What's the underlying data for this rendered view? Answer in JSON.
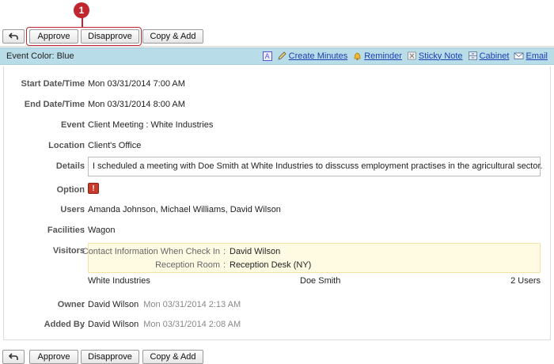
{
  "callout": {
    "number": "1"
  },
  "toolbar": {
    "approve_label": "Approve",
    "disapprove_label": "Disapprove",
    "copy_add_label": "Copy & Add"
  },
  "event_color": "Event Color: Blue",
  "actions": [
    {
      "label": "A",
      "icon": "label-icon"
    },
    {
      "label": "Create Minutes",
      "icon": "pencil-icon"
    },
    {
      "label": "Reminder",
      "icon": "bell-icon"
    },
    {
      "label": "Sticky Note",
      "icon": "sticky-note-icon"
    },
    {
      "label": "Cabinet",
      "icon": "cabinet-icon"
    },
    {
      "label": "Email",
      "icon": "envelope-icon"
    }
  ],
  "fields": {
    "start": {
      "label": "Start Date/Time",
      "value": "Mon 03/31/2014 7:00 AM"
    },
    "end": {
      "label": "End Date/Time",
      "value": "Mon 03/31/2014 8:00 AM"
    },
    "event": {
      "label": "Event",
      "value": "Client Meeting : White Industries"
    },
    "location": {
      "label": "Location",
      "value": "Client's Office"
    },
    "details": {
      "label": "Details",
      "value": "I scheduled a meeting with Doe Smith at White Industries to disscuss employment practises in the agricultural sector."
    },
    "option": {
      "label": "Option",
      "value": "!"
    },
    "users": {
      "label": "Users",
      "value": "Amanda Johnson, Michael Williams, David Wilson"
    },
    "facilities": {
      "label": "Facilities",
      "value": "Wagon"
    },
    "visitors": {
      "label": "Visitors",
      "contact_label": "Contact Information When Check In",
      "contact_value": "David Wilson",
      "room_label": "Reception Room",
      "room_value": "Reception Desk (NY)",
      "company": "White Industries",
      "person": "Doe Smith",
      "count": "2 Users"
    },
    "owner": {
      "label": "Owner",
      "name": "David Wilson",
      "time": "Mon 03/31/2014 2:13 AM"
    },
    "added_by": {
      "label": "Added By",
      "name": "David Wilson",
      "time": "Mon 03/31/2014 2:08 AM"
    }
  },
  "colors": {
    "accent": "#c0262d",
    "header_bar": "#b9dde8",
    "link": "#1a3fb3",
    "visitor_bg": "#fffbe3"
  }
}
